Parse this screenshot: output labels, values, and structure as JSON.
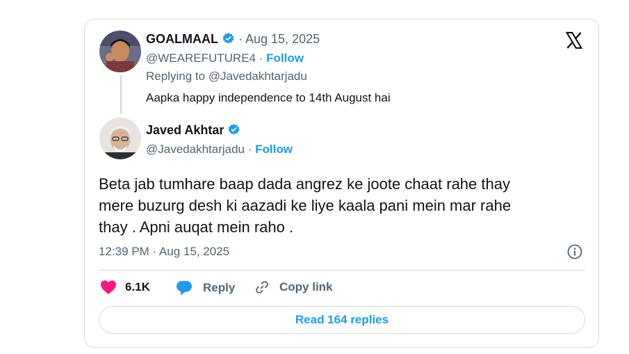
{
  "colors": {
    "accent": "#1d9bf0",
    "like": "#f91880",
    "muted": "#536471",
    "border": "#cfd9de"
  },
  "reply_tweet": {
    "author_name": "GOALMAAL",
    "separator_date": "· Aug 15, 2025",
    "handle": "@WEAREFUTURE4 ·",
    "follow_label": "Follow",
    "replying_to_prefix": "Replying to",
    "replying_to_handle": "@Javedakhtarjadu",
    "text": "Aapka happy independence to 14th August hai"
  },
  "main_tweet": {
    "author_name": "Javed Akhtar",
    "handle": "@Javedakhtarjadu ·",
    "follow_label": "Follow",
    "text_line1": "Beta jab tumhare baap dada angrez ke joote chaat rahe thay",
    "text_line2": "mere buzurg desh ki aazadi ke liye kaala pani mein mar rahe",
    "text_line3": "thay . Apni auqat mein raho .",
    "timestamp": "12:39 PM · Aug 15, 2025"
  },
  "actions": {
    "likes": "6.1K",
    "reply_label": "Reply",
    "copy_link_label": "Copy link"
  },
  "read_replies_label": "Read 164 replies",
  "icons": [
    "x-logo-icon",
    "verified-badge-icon",
    "info-icon",
    "heart-icon",
    "reply-bubble-icon",
    "link-icon"
  ]
}
